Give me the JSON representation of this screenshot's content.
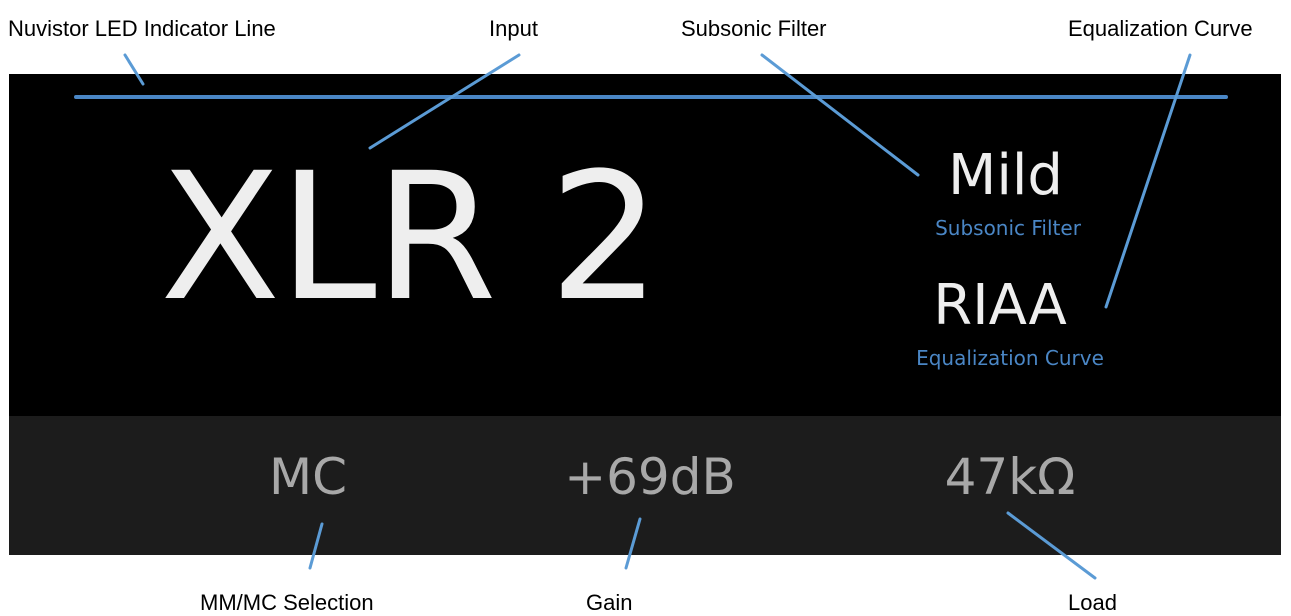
{
  "display": {
    "input": "XLR 2",
    "subsonic_value": "Mild",
    "subsonic_caption": "Subsonic Filter",
    "eq_value": "RIAA",
    "eq_caption": "Equalization Curve",
    "cartridge_mode": "MC",
    "gain": "+69dB",
    "load": "47kΩ"
  },
  "callouts": {
    "led_line": "Nuvistor LED Indicator Line",
    "input": "Input",
    "subsonic_filter": "Subsonic Filter",
    "equalization_curve": "Equalization Curve",
    "mm_mc_selection": "MM/MC Selection",
    "gain": "Gain",
    "load": "Load"
  },
  "colors": {
    "accent": "#4a86c5",
    "callout_line": "#5b9bd5",
    "display_bg": "#000000",
    "bottom_bar_bg": "#1c1c1c"
  }
}
